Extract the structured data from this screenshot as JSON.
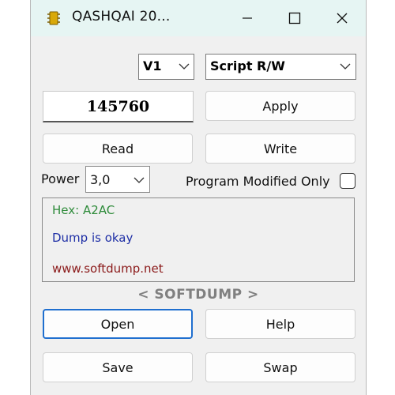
{
  "window": {
    "title": "QASHQAI 20...",
    "icon": "chip-icon"
  },
  "titlebar_controls": [
    "minimize-icon",
    "maximize-icon",
    "close-icon"
  ],
  "version_select": {
    "value": "V1"
  },
  "mode_select": {
    "value": "Script R/W"
  },
  "value_field": {
    "value": "145760"
  },
  "buttons": {
    "apply": "Apply",
    "read": "Read",
    "write": "Write",
    "open": "Open",
    "help": "Help",
    "save": "Save",
    "swap": "Swap"
  },
  "power": {
    "label": "Power",
    "value": "3,0"
  },
  "program_modified": {
    "label": "Program Modified Only",
    "checked": false
  },
  "log": [
    {
      "text": "Hex: A2AC",
      "color": "#2e8b3a"
    },
    {
      "text": "Dump is okay",
      "color": "#1f2fa6"
    },
    {
      "text": "www.softdump.net",
      "color": "#8b1a1a"
    }
  ],
  "brand": "< SOFTDUMP >"
}
